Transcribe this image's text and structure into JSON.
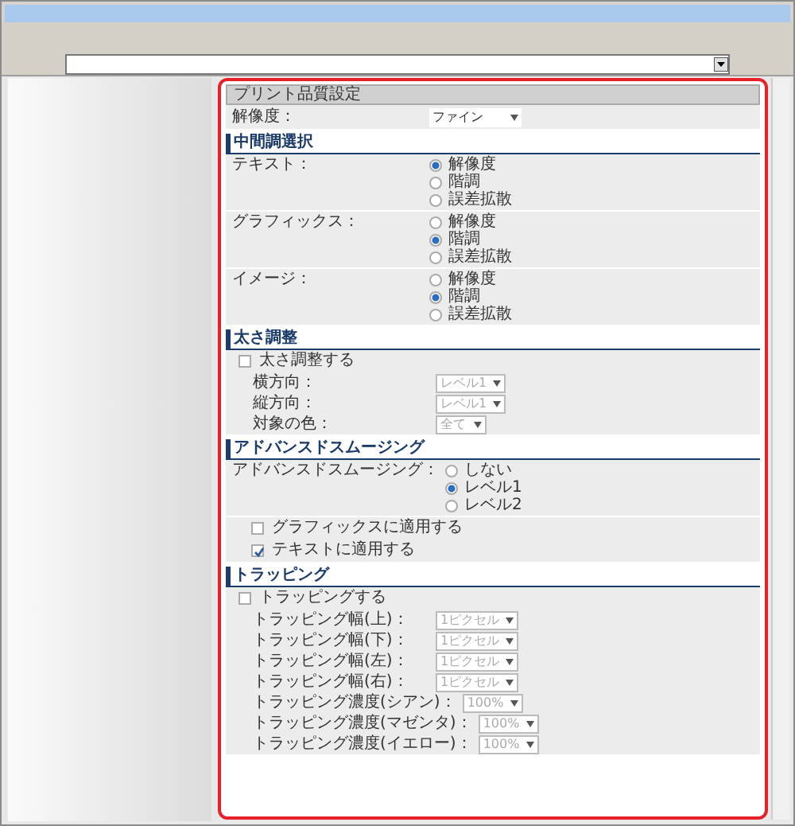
{
  "panel_title": "プリント品質設定",
  "resolution": {
    "label": "解像度：",
    "value": "ファイン"
  },
  "sections": [
    {
      "title": "中間調選択",
      "items": [
        {
          "kind": "radio_group",
          "label": "テキスト：",
          "options": [
            {
              "label": "解像度",
              "selected": true
            },
            {
              "label": "階調",
              "selected": false
            },
            {
              "label": "誤差拡散",
              "selected": false
            }
          ]
        },
        {
          "kind": "radio_group",
          "label": "グラフィックス：",
          "options": [
            {
              "label": "解像度",
              "selected": false
            },
            {
              "label": "階調",
              "selected": true
            },
            {
              "label": "誤差拡散",
              "selected": false
            }
          ]
        },
        {
          "kind": "radio_group",
          "label": "イメージ：",
          "options": [
            {
              "label": "解像度",
              "selected": false
            },
            {
              "label": "階調",
              "selected": true
            },
            {
              "label": "誤差拡散",
              "selected": false
            }
          ]
        }
      ]
    },
    {
      "title": "太さ調整",
      "items": [
        {
          "kind": "checkbox",
          "label": "太さ調整する",
          "checked": false
        },
        {
          "kind": "select",
          "label": "横方向：",
          "value": "レベル1",
          "disabled": true
        },
        {
          "kind": "select",
          "label": "縦方向：",
          "value": "レベル1",
          "disabled": true
        },
        {
          "kind": "select",
          "label": "対象の色：",
          "value": "全て",
          "disabled": true
        }
      ]
    },
    {
      "title": "アドバンスドスムージング",
      "items": [
        {
          "kind": "radio_group",
          "label": "アドバンスドスムージング：",
          "options": [
            {
              "label": "しない",
              "selected": false
            },
            {
              "label": "レベル1",
              "selected": true
            },
            {
              "label": "レベル2",
              "selected": false
            }
          ]
        },
        {
          "kind": "sub_checkbox",
          "label": "グラフィックスに適用する",
          "checked": false
        },
        {
          "kind": "sub_checkbox",
          "label": "テキストに適用する",
          "checked": true
        }
      ]
    },
    {
      "title": "トラッピング",
      "items": [
        {
          "kind": "checkbox",
          "label": "トラッピングする",
          "checked": false
        },
        {
          "kind": "select",
          "label": "トラッピング幅(上)：",
          "value": "1ピクセル",
          "disabled": true
        },
        {
          "kind": "select",
          "label": "トラッピング幅(下)：",
          "value": "1ピクセル",
          "disabled": true
        },
        {
          "kind": "select",
          "label": "トラッピング幅(左)：",
          "value": "1ピクセル",
          "disabled": true
        },
        {
          "kind": "select",
          "label": "トラッピング幅(右)：",
          "value": "1ピクセル",
          "disabled": true
        },
        {
          "kind": "select",
          "label": "トラッピング濃度(シアン)：",
          "value": "100%",
          "disabled": true
        },
        {
          "kind": "select",
          "label": "トラッピング濃度(マゼンタ)：",
          "value": "100%",
          "disabled": true
        },
        {
          "kind": "select",
          "label": "トラッピング濃度(イエロー)：",
          "value": "100%",
          "disabled": true
        }
      ]
    }
  ]
}
